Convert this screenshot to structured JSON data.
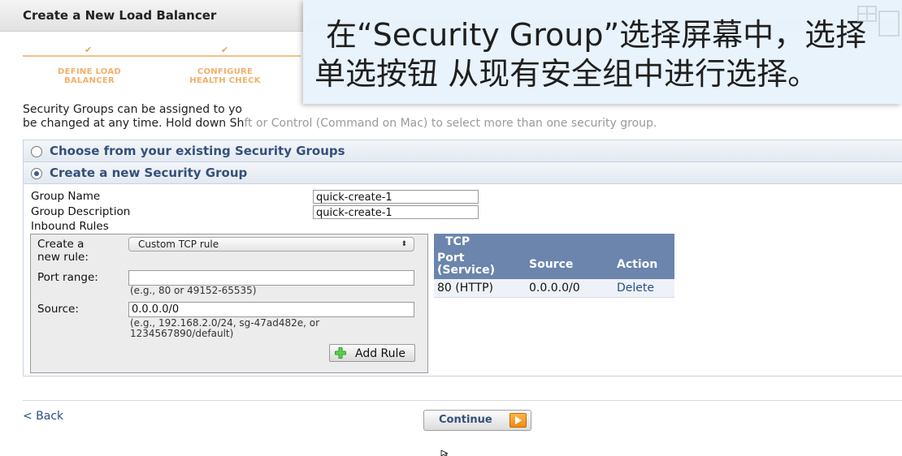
{
  "dialog": {
    "title": "Create a New Load Balancer"
  },
  "steps": [
    {
      "label_line1": "DEFINE LOAD",
      "label_line2": "BALANCER"
    },
    {
      "label_line1": "CONFIGURE",
      "label_line2": "HEALTH CHECK"
    }
  ],
  "intro": {
    "line1": "Security Groups can be assigned to yo",
    "line2_a": "be changed at any time. Hold down Sh",
    "line2_b": "ft or Control (Command on Mac) to select more than one security group."
  },
  "options": {
    "existing_label": "Choose from your existing Security Groups",
    "new_label": "Create a new Security Group",
    "selected": "new"
  },
  "form": {
    "group_name_label": "Group Name",
    "group_name_value": "quick-create-1",
    "group_description_label": "Group Description",
    "group_description_value": "quick-create-1",
    "inbound_rules_label": "Inbound Rules"
  },
  "rule": {
    "create_label": "Create a new rule:",
    "create_label_line1": "Create a",
    "create_label_line2": "new rule:",
    "rule_type_value": "Custom TCP rule",
    "port_range_label": "Port range:",
    "port_range_value": "",
    "port_range_hint": "(e.g., 80 or 49152-65535)",
    "source_label": "Source:",
    "source_value": "0.0.0.0/0",
    "source_hint_line1": "(e.g., 192.168.2.0/24, sg-47ad482e, or",
    "source_hint_line2": "1234567890/default)",
    "add_rule_label": "Add Rule"
  },
  "tcp_table": {
    "title": "TCP",
    "columns": [
      "Port (Service)",
      "Source",
      "Action"
    ],
    "col_port_line1": "Port",
    "col_port_line2": "(Service)",
    "rows": [
      {
        "port": "80 (HTTP)",
        "source": "0.0.0.0/0",
        "action": "Delete"
      }
    ]
  },
  "footer": {
    "back_label": "< Back",
    "continue_label": "Continue"
  },
  "subtitle": {
    "line1": "在“Security Group”选择屏幕中，选择",
    "line2": "单选按钮 从现有安全组中进行选择。"
  },
  "colors": {
    "accent_blue": "#34507a",
    "table_header": "#6b85ad",
    "step_orange": "#f0b06a",
    "continue_orange": "#f08a14",
    "add_green": "#2e9e2e"
  },
  "icons": {
    "add_rule": "plus-icon",
    "continue": "play-arrow-icon",
    "select": "chevron-updown-icon"
  }
}
